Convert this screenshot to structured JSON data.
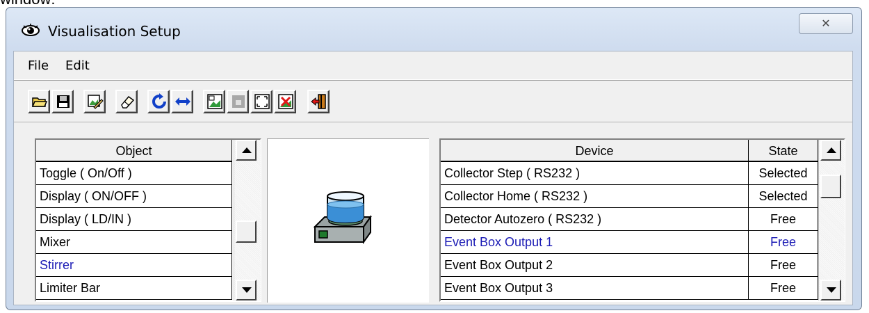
{
  "caption": "window:",
  "window": {
    "title": "Visualisation Setup",
    "close_glyph": "✕"
  },
  "menu": [
    "File",
    "Edit"
  ],
  "toolbar": [
    {
      "icon": "open-folder-icon"
    },
    {
      "icon": "save-disk-icon"
    },
    {
      "icon": "edit-picture-icon"
    },
    {
      "icon": "eraser-icon"
    },
    {
      "icon": "refresh-icon"
    },
    {
      "icon": "swap-arrows-icon"
    },
    {
      "icon": "picture-icon"
    },
    {
      "icon": "disabled-icon"
    },
    {
      "icon": "fit-window-icon"
    },
    {
      "icon": "delete-picture-icon"
    },
    {
      "icon": "exit-door-icon"
    }
  ],
  "object_list": {
    "header": "Object",
    "items": [
      {
        "label": "Toggle ( On/Off )",
        "highlight": false
      },
      {
        "label": "Display ( ON/OFF )",
        "highlight": false
      },
      {
        "label": "Display ( LD/IN )",
        "highlight": false
      },
      {
        "label": "Mixer",
        "highlight": false
      },
      {
        "label": "Stirrer",
        "highlight": true
      },
      {
        "label": "Limiter Bar",
        "highlight": false
      }
    ]
  },
  "device_list": {
    "headers": {
      "device": "Device",
      "state": "State"
    },
    "rows": [
      {
        "device": "Collector Step ( RS232 )",
        "state": "Selected",
        "highlight": false
      },
      {
        "device": "Collector Home ( RS232 )",
        "state": "Selected",
        "highlight": false
      },
      {
        "device": "Detector Autozero ( RS232 )",
        "state": "Free",
        "highlight": false
      },
      {
        "device": "Event Box Output 1",
        "state": "Free",
        "highlight": true
      },
      {
        "device": "Event Box Output 2",
        "state": "Free",
        "highlight": false
      },
      {
        "device": "Event Box Output 3",
        "state": "Free",
        "highlight": false
      }
    ]
  },
  "preview": {
    "icon": "stirrer-icon"
  },
  "colors": {
    "highlight_text": "#1b1bb5",
    "window_frame": "#c9d8ec"
  }
}
